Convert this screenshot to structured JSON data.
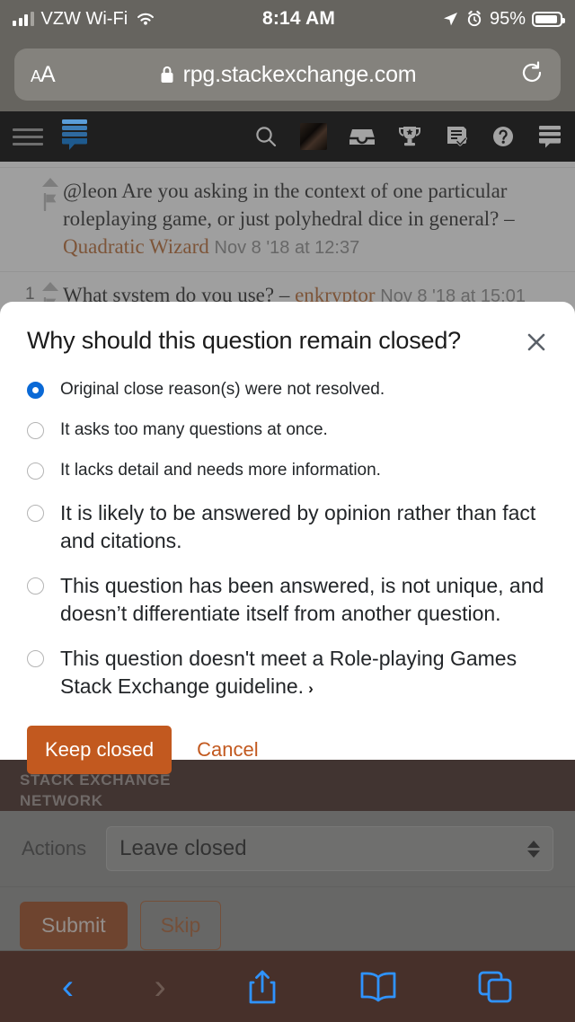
{
  "status_bar": {
    "carrier": "VZW Wi-Fi",
    "time": "8:14 AM",
    "battery_percent": "95%",
    "icons": [
      "signal-bars-icon",
      "wifi-icon",
      "location-arrow-icon",
      "alarm-clock-icon",
      "battery-icon"
    ]
  },
  "browser": {
    "text_size_label_big": "A",
    "text_size_label_small": "A",
    "url": "rpg.stackexchange.com",
    "lock_icon": "lock-icon",
    "reload_icon": "reload-icon"
  },
  "site_nav": {
    "menu_icon": "hamburger-menu-icon",
    "logo_icon": "stack-exchange-logo-icon",
    "icons": [
      "search-icon",
      "user-avatar-icon",
      "inbox-icon",
      "trophy-icon",
      "review-icon",
      "help-icon",
      "stack-exchange-icon"
    ]
  },
  "comments": [
    {
      "score": "",
      "body": "@leon Are you asking in the context of one particular roleplaying game, or just polyhedral dice in general? – ",
      "user": "Quadratic Wizard",
      "date": "Nov 8 '18 at 12:37"
    },
    {
      "score": "1",
      "body": "What system do you use? – ",
      "user": "enkryptor",
      "date": "Nov 8 '18 at 15:01"
    }
  ],
  "site_footer": {
    "line1": "STACK EXCHANGE",
    "line2": "NETWORK"
  },
  "review": {
    "actions_label": "Actions",
    "selected_action": "Leave closed",
    "submit_label": "Submit",
    "skip_label": "Skip"
  },
  "modal": {
    "title": "Why should this question remain closed?",
    "close_icon": "close-icon",
    "options": [
      {
        "label": "Original close reason(s) were not resolved.",
        "selected": true,
        "large": false,
        "chevron": ""
      },
      {
        "label": "It asks too many questions at once.",
        "selected": false,
        "large": false,
        "chevron": ""
      },
      {
        "label": "It lacks detail and needs more information.",
        "selected": false,
        "large": false,
        "chevron": ""
      },
      {
        "label": "It is likely to be answered by opinion rather than fact and citations.",
        "selected": false,
        "large": true,
        "chevron": ""
      },
      {
        "label": "This question has been answered, is not unique, and doesn’t differentiate itself from another question.",
        "selected": false,
        "large": true,
        "chevron": ""
      },
      {
        "label": "This question doesn't meet a Role-playing Games Stack Exchange guideline.",
        "selected": false,
        "large": true,
        "chevron": "›"
      }
    ],
    "keep_closed_label": "Keep closed",
    "cancel_label": "Cancel"
  },
  "toolbar": {
    "back_icon": "chevron-left-icon",
    "forward_icon": "chevron-right-icon",
    "share_icon": "share-icon",
    "bookmarks_icon": "book-icon",
    "tabs_icon": "tabs-icon",
    "back_glyph": "‹",
    "forward_glyph": "›"
  },
  "colors": {
    "accent_orange": "#c2591f",
    "radio_blue": "#0a69d6",
    "footer_brown": "#3b211a",
    "toolbar_brown": "#47302a"
  }
}
